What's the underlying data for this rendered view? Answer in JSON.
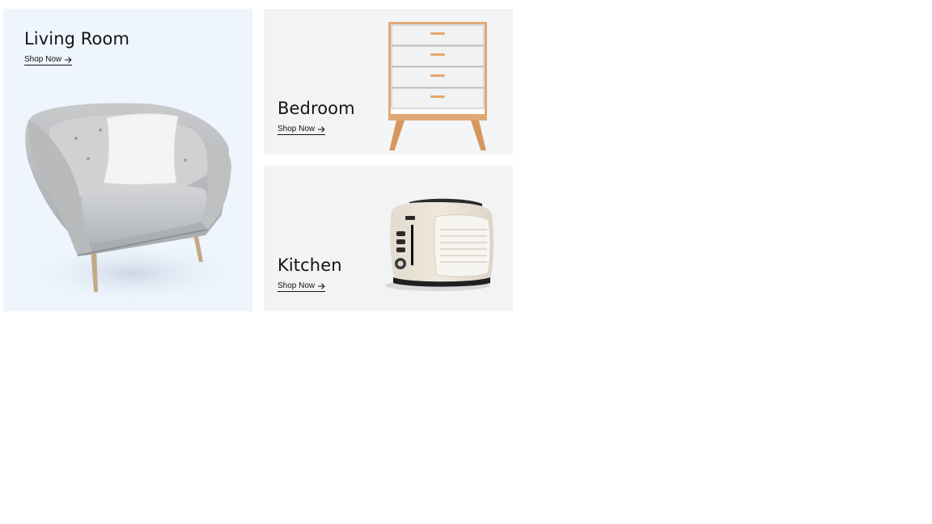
{
  "categories": {
    "living": {
      "title": "Living Room",
      "cta": "Shop Now",
      "cta_icon": "arrow-right-icon",
      "image": "armchair-icon",
      "background": "#eef5fd"
    },
    "bedroom": {
      "title": "Bedroom",
      "cta": "Shop Now",
      "cta_icon": "arrow-right-icon",
      "image": "dresser-icon",
      "background": "#f2f3f5"
    },
    "kitchen": {
      "title": "Kitchen",
      "cta": "Shop Now",
      "cta_icon": "arrow-right-icon",
      "image": "toaster-icon",
      "background": "#f2f3f5"
    }
  }
}
